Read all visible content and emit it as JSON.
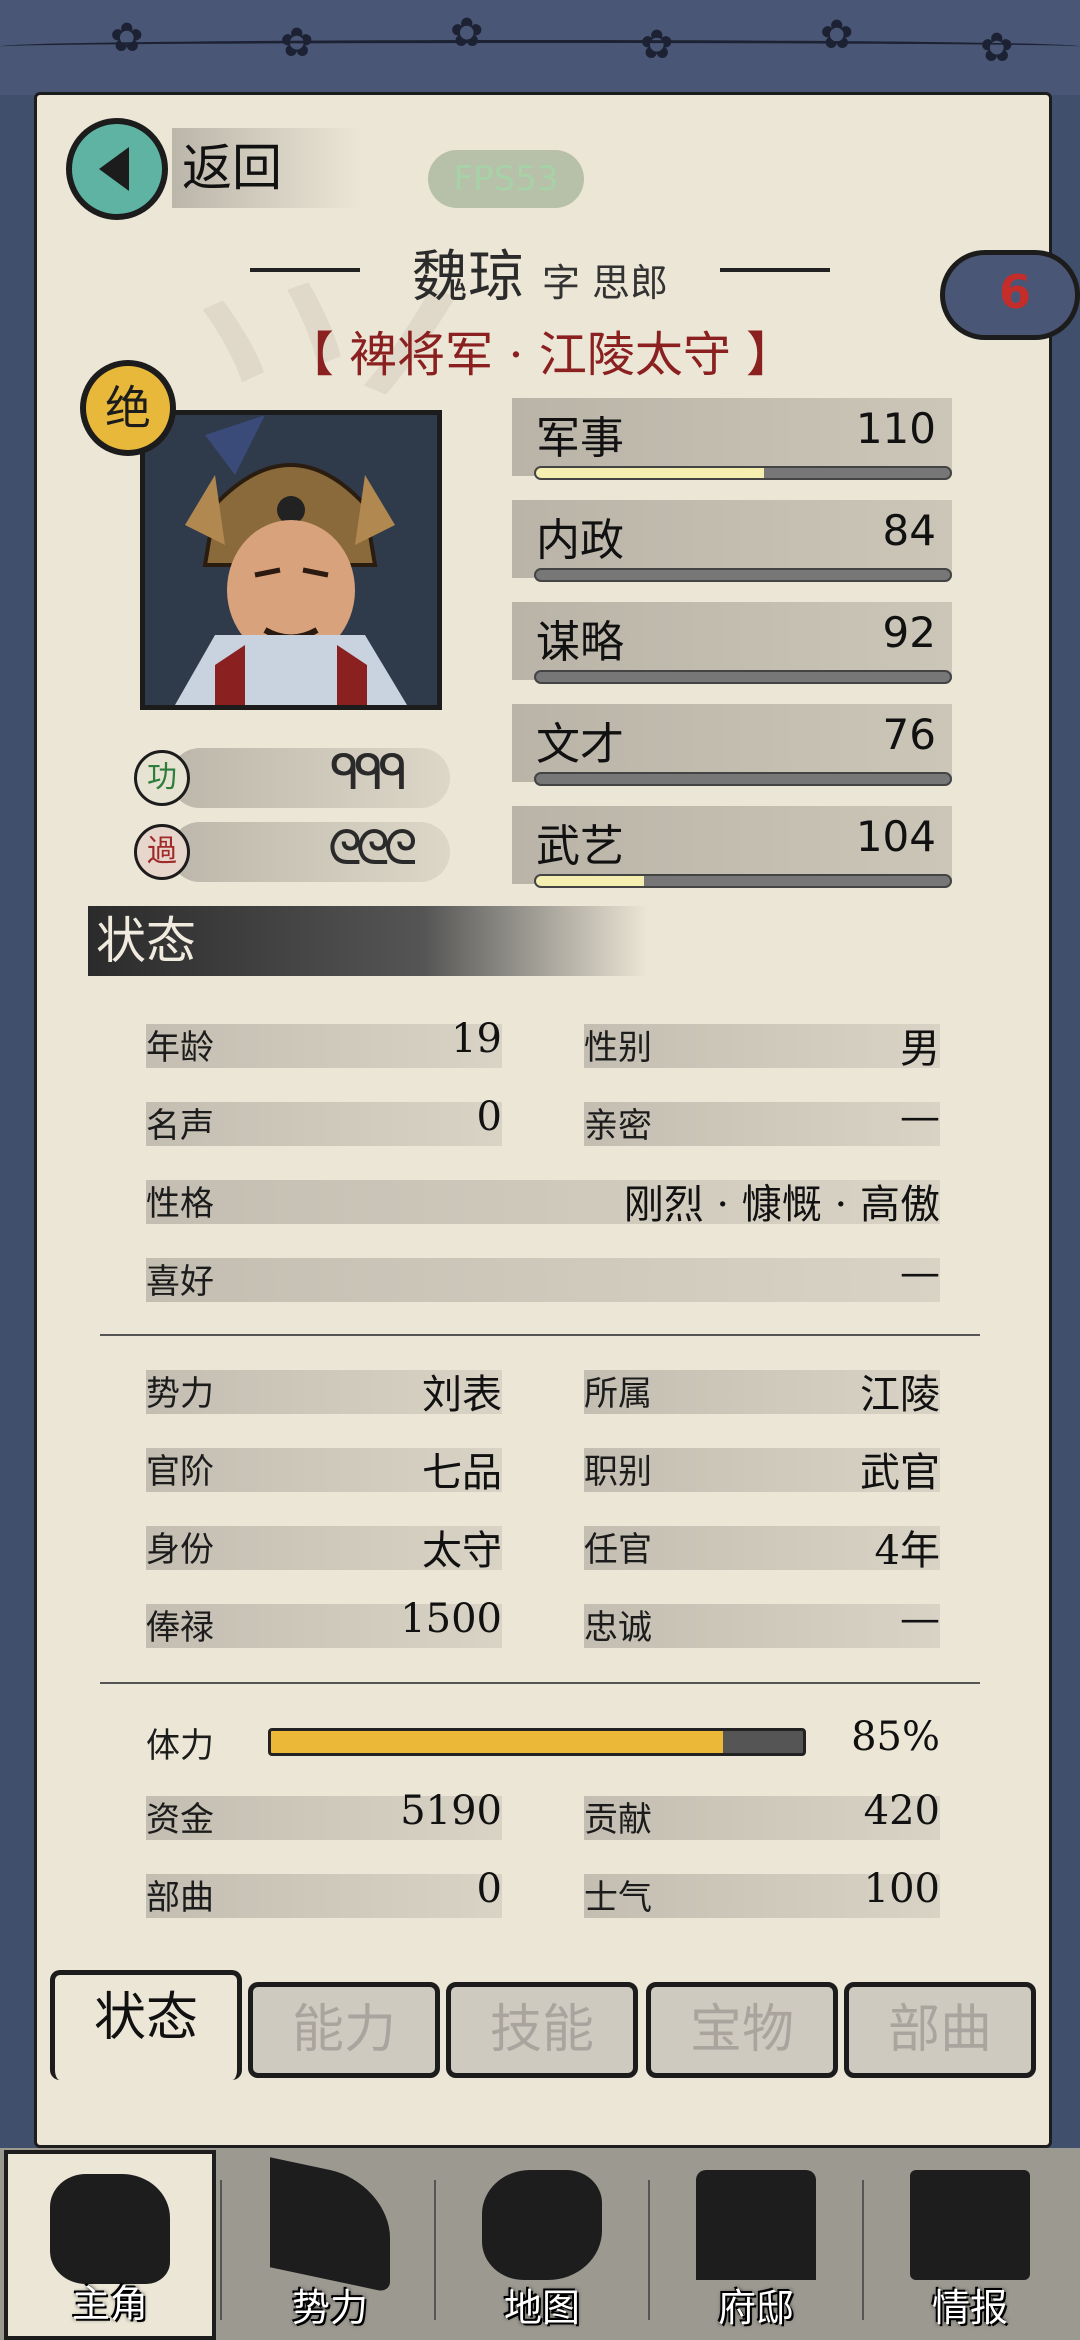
{
  "header": {
    "back_label": "返回",
    "fps": "FPS53"
  },
  "general": {
    "name": "魏琼",
    "courtesy": "字 思郎",
    "rank": "【 裨将军 · 江陵太守 】",
    "grade_badge": "绝",
    "notification_count": "6"
  },
  "merit": {
    "label": "功",
    "marks": "ᑫᑫᑫ"
  },
  "demerit": {
    "label": "過",
    "marks": "ᘓᘓᘓ"
  },
  "stats": [
    {
      "label": "军事",
      "value": "110",
      "fill": 0.55
    },
    {
      "label": "内政",
      "value": "84",
      "fill": 0
    },
    {
      "label": "谋略",
      "value": "92",
      "fill": 0
    },
    {
      "label": "文才",
      "value": "76",
      "fill": 0
    },
    {
      "label": "武艺",
      "value": "104",
      "fill": 0.26
    }
  ],
  "section_title": "状态",
  "info": {
    "age_label": "年龄",
    "age": "19",
    "gender_label": "性别",
    "gender": "男",
    "fame_label": "名声",
    "fame": "0",
    "intimacy_label": "亲密",
    "intimacy": "—",
    "personality_label": "性格",
    "personality": "刚烈 · 慷慨 · 高傲",
    "hobby_label": "喜好",
    "hobby": "—",
    "faction_label": "势力",
    "faction": "刘表",
    "location_label": "所属",
    "location": "江陵",
    "rank_label": "官阶",
    "rank": "七品",
    "position_label": "职别",
    "position": "武官",
    "identity_label": "身份",
    "identity": "太守",
    "tenure_label": "任官",
    "tenure": "4年",
    "salary_label": "俸禄",
    "salary": "1500",
    "loyalty_label": "忠诚",
    "loyalty": "—",
    "stamina_label": "体力",
    "stamina": "85%",
    "stamina_fill": 0.85,
    "funds_label": "资金",
    "funds": "5190",
    "contribution_label": "贡献",
    "contribution": "420",
    "troops_label": "部曲",
    "troops": "0",
    "morale_label": "士气",
    "morale": "100"
  },
  "tabs": [
    "状态",
    "能力",
    "技能",
    "宝物",
    "部曲"
  ],
  "nav": [
    "主角",
    "势力",
    "地图",
    "府邸",
    "情报"
  ],
  "colors": {
    "accent_gold": "#ebb838",
    "teal": "#5fb3a3",
    "rank_red": "#8a2020",
    "frame_blue": "#40506c"
  }
}
